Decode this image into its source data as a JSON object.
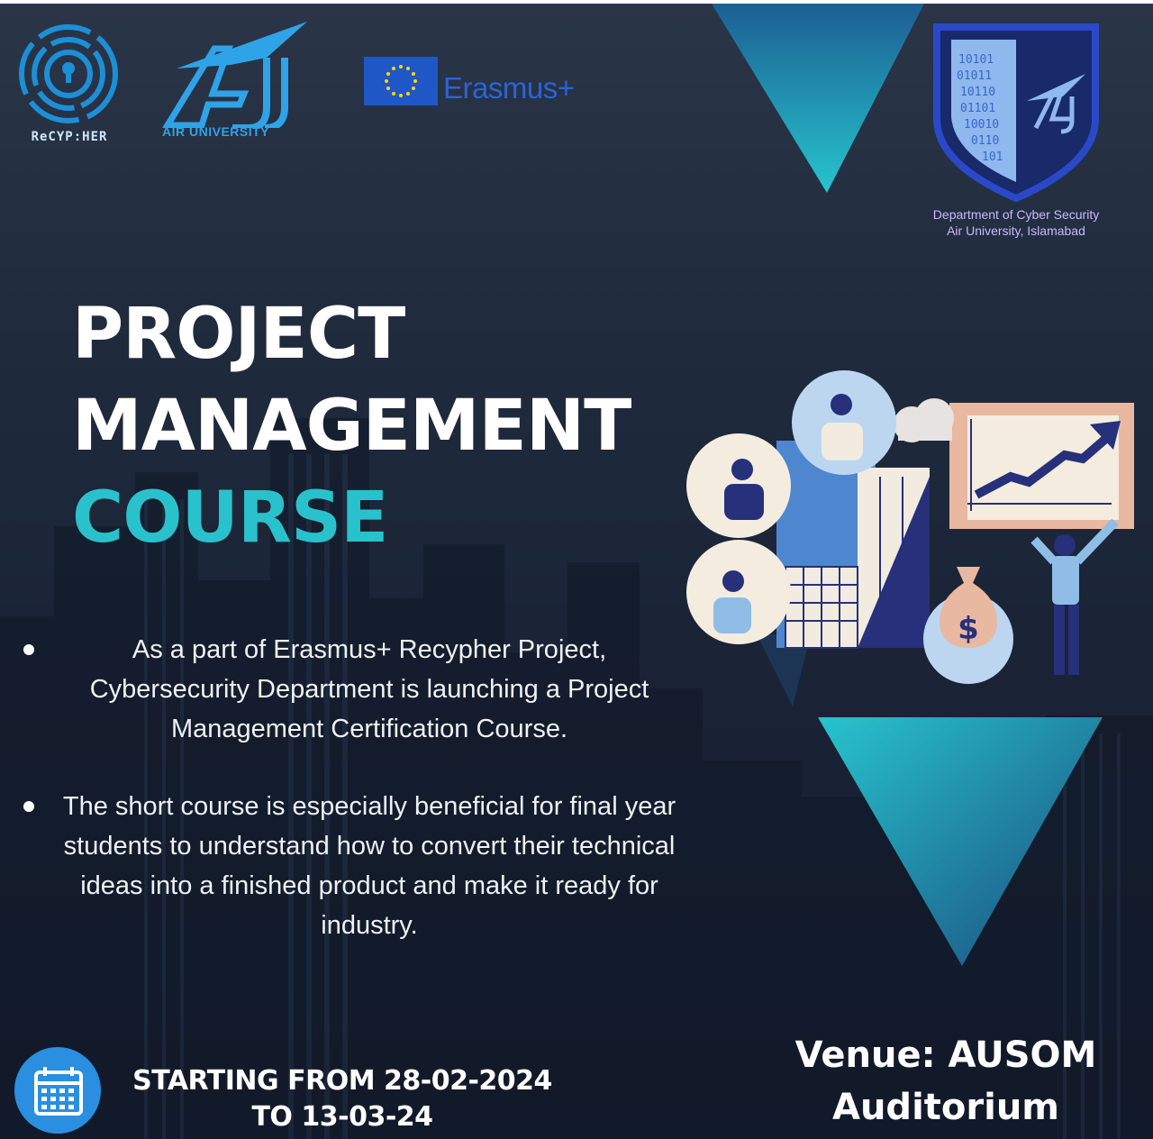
{
  "logos": {
    "recypher": "ReCYP:HER",
    "air_university": "AIR UNIVERSITY",
    "erasmus": "Erasmus+"
  },
  "department": {
    "line1": "Department of Cyber Security",
    "line2": "Air University, Islamabad"
  },
  "title": {
    "line1": "PROJECT",
    "line2": "MANAGEMENT",
    "line3": "COURSE"
  },
  "bullets": [
    {
      "text": "As a part of Erasmus+ Recypher Project, Cybersecurity Department is launching a Project Management Certification Course."
    },
    {
      "text": "The short course is especially beneficial for final year students to understand how to convert their technical ideas into a finished product and make it ready for industry."
    }
  ],
  "dates": {
    "line1": "STARTING FROM 28-02-2024",
    "line2": "TO 13-03-24"
  },
  "venue": {
    "line1": "Venue: AUSOM",
    "line2": "Auditorium"
  },
  "illustration": {
    "symbol": "$"
  },
  "colors": {
    "accent": "#29c2cc",
    "background": "#1f2b3d",
    "calendar": "#2a8fe0"
  }
}
